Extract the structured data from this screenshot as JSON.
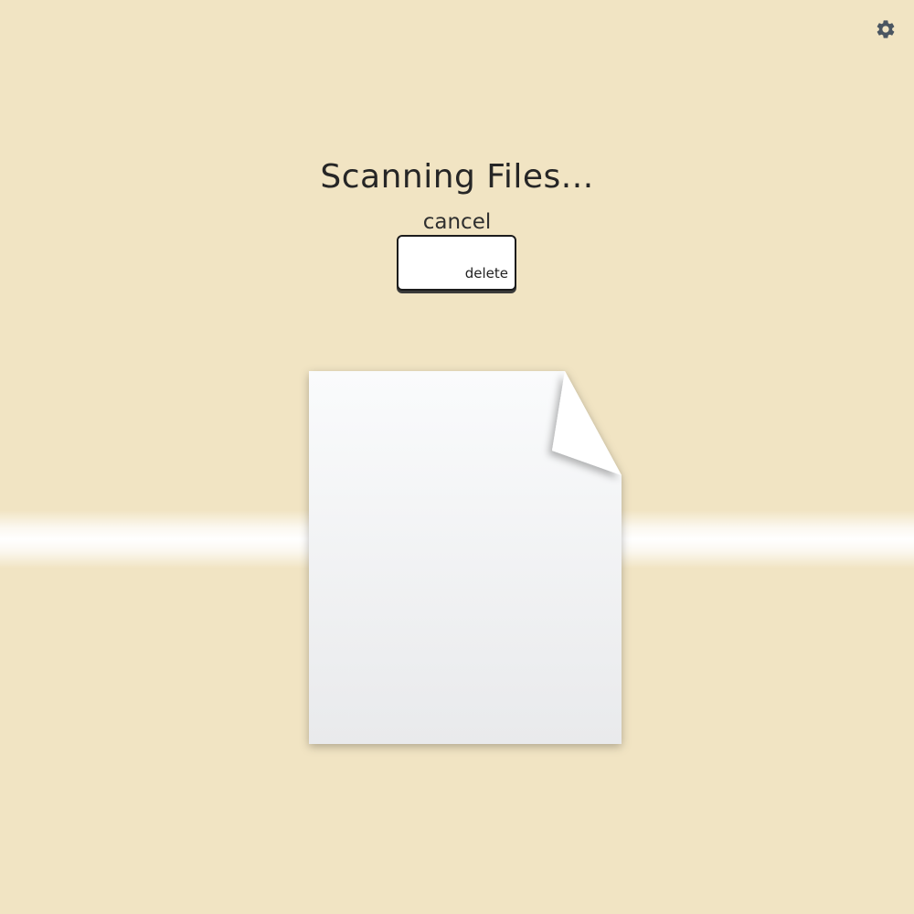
{
  "title": "Scanning Files...",
  "cancel_label": "cancel",
  "delete_key_label": "delete",
  "settings_icon": "gear-icon",
  "document_icon": "document-icon",
  "colors": {
    "background": "#f1e4c3",
    "text": "#262626",
    "gear": "#4a5561",
    "key_border": "#1c1c1c"
  }
}
